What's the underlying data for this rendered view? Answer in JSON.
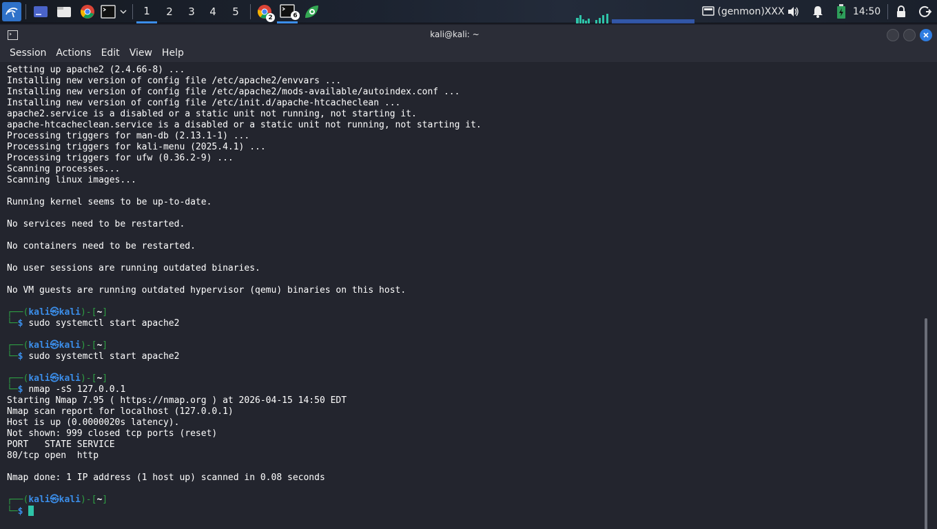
{
  "panel": {
    "workspaces": [
      "1",
      "2",
      "3",
      "4",
      "5"
    ],
    "chrome_badge": "2",
    "terminal_badge": "6",
    "genmon": "(genmon)XXX",
    "clock": "14:50"
  },
  "window": {
    "title": "kali@kali: ~",
    "menu": [
      "Session",
      "Actions",
      "Edit",
      "View",
      "Help"
    ]
  },
  "terminal": {
    "output_top": [
      "Setting up apache2 (2.4.66-8) ...",
      "Installing new version of config file /etc/apache2/envvars ...",
      "Installing new version of config file /etc/apache2/mods-available/autoindex.conf ...",
      "Installing new version of config file /etc/init.d/apache-htcacheclean ...",
      "apache2.service is a disabled or a static unit not running, not starting it.",
      "apache-htcacheclean.service is a disabled or a static unit not running, not starting it.",
      "Processing triggers for man-db (2.13.1-1) ...",
      "Processing triggers for kali-menu (2025.4.1) ...",
      "Processing triggers for ufw (0.36.2-9) ...",
      "Scanning processes...",
      "Scanning linux images...",
      "",
      "Running kernel seems to be up-to-date.",
      "",
      "No services need to be restarted.",
      "",
      "No containers need to be restarted.",
      "",
      "No user sessions are running outdated binaries.",
      "",
      "No VM guests are running outdated hypervisor (qemu) binaries on this host.",
      ""
    ],
    "prompt": {
      "head": "┌──(",
      "user": "kali",
      "at": "㉿",
      "host": "kali",
      "mid": ")-[",
      "dir": "~",
      "end": "]",
      "tail": "└─",
      "dollar": "$"
    },
    "cmd1": "sudo systemctl start apache2",
    "cmd2": "sudo systemctl start apache2",
    "cmd3": "nmap -sS 127.0.0.1",
    "nmap_output": [
      "Starting Nmap 7.95 ( https://nmap.org ) at 2026-04-15 14:50 EDT",
      "Nmap scan report for localhost (127.0.0.1)",
      "Host is up (0.0000020s latency).",
      "Not shown: 999 closed tcp ports (reset)",
      "PORT   STATE SERVICE",
      "80/tcp open  http",
      "",
      "Nmap done: 1 IP address (1 host up) scanned in 0.08 seconds",
      ""
    ]
  }
}
